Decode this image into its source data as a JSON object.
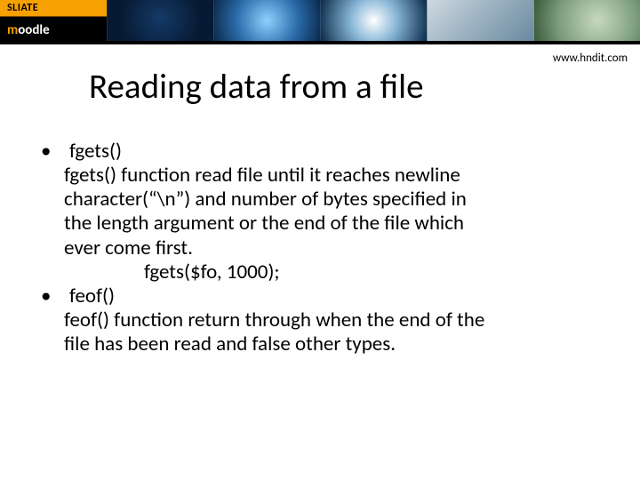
{
  "banner": {
    "logo_top": "SLIATE",
    "logo_bottom_a": "m",
    "logo_bottom_b": "oodle"
  },
  "url": "www.hndit.com",
  "title": "Reading data from a file",
  "bullets": {
    "b1": "fgets()",
    "b1_desc_l1": "fgets() function read file until it reaches newline",
    "b1_desc_l2": "character(“\\n”)  and number of bytes specified in",
    "b1_desc_l3": "the length argument or the end of the file which",
    "b1_desc_l4": "ever come first.",
    "b1_code": "fgets($fo, 1000);",
    "b2": "feof()",
    "b2_desc_l1": "feof() function return through when the end of the",
    "b2_desc_l2": "file has been read and false other types."
  }
}
